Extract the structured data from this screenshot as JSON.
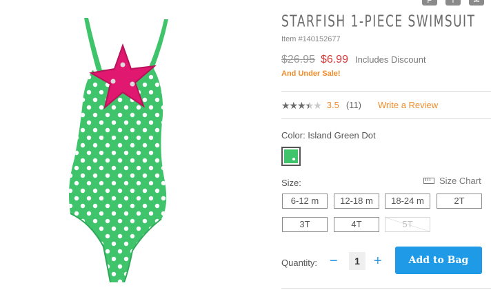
{
  "product": {
    "title": "STARFISH 1-PIECE SWIMSUIT",
    "item_number": "Item #140152677",
    "image_icon": "green-polka-dot-swimsuit-with-pink-starfish",
    "old_price": "$26.95",
    "new_price": "$6.99",
    "discount_note": "Includes Discount",
    "sale_note": "And Under Sale!"
  },
  "share_icons": [
    "pinterest-icon",
    "facebook-icon",
    "email-icon"
  ],
  "rating": {
    "value": "3.5",
    "max": 5,
    "count": "(11)",
    "write_review": "Write a Review"
  },
  "color": {
    "label": "Color: Island Green Dot",
    "swatch_hex": "#3fc46b"
  },
  "size": {
    "label": "Size:",
    "chart_label": "Size Chart",
    "options": [
      {
        "label": "6-12 m",
        "available": true
      },
      {
        "label": "12-18 m",
        "available": true
      },
      {
        "label": "18-24 m",
        "available": true
      },
      {
        "label": "2T",
        "available": true
      },
      {
        "label": "3T",
        "available": true
      },
      {
        "label": "4T",
        "available": true
      },
      {
        "label": "5T",
        "available": false
      }
    ]
  },
  "quantity": {
    "label": "Quantity:",
    "value": "1",
    "minus": "−",
    "plus": "+"
  },
  "cart": {
    "add_label": "Add to Bag"
  },
  "colors": {
    "accent": "#1f9ae6",
    "sale": "#d23a3a",
    "highlight": "#f08a2a",
    "swimsuit": "#3fc46b",
    "starfish": "#e0186f"
  }
}
